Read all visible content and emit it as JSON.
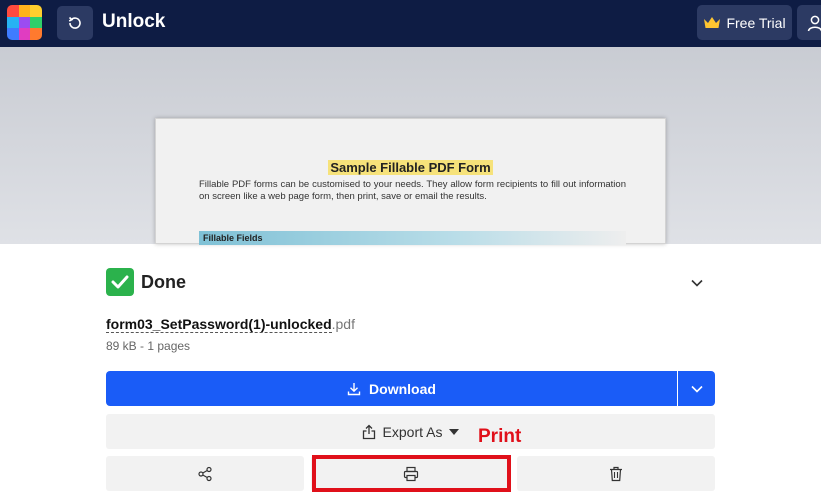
{
  "header": {
    "title": "Unlock",
    "free_trial_label": "Free Trial",
    "logo_colors": [
      "#ff4b3e",
      "#ffb21d",
      "#ffcf2e",
      "#27b3f3",
      "#9b4cf1",
      "#2fd06a",
      "#3f7cff",
      "#e03dc1",
      "#ff7a2e"
    ]
  },
  "preview": {
    "pdf_title": "Sample Fillable PDF Form",
    "pdf_body": "Fillable PDF forms can be customised to your needs. They allow form recipients to fill out information on screen like a web page form, then print, save or email the results.",
    "pdf_section": "Fillable Fields"
  },
  "result": {
    "status": "Done",
    "file_base": "form03_SetPassword(1)-unlocked",
    "file_ext": ".pdf",
    "file_meta": "89 kB - 1 pages",
    "download_label": "Download",
    "export_label": "Export As"
  },
  "annotation": {
    "print_label": "Print",
    "color": "#e0101a"
  },
  "icons": {
    "back": "undo-icon",
    "crown": "crown-icon",
    "user": "user-icon",
    "check": "check-icon",
    "chevron": "chevron-down-icon",
    "download": "download-icon",
    "export": "export-icon",
    "share": "share-icon",
    "print": "printer-icon",
    "delete": "trash-icon"
  },
  "colors": {
    "topbar": "#0e1c44",
    "primary": "#1a5cf7",
    "success": "#2bb24c"
  }
}
